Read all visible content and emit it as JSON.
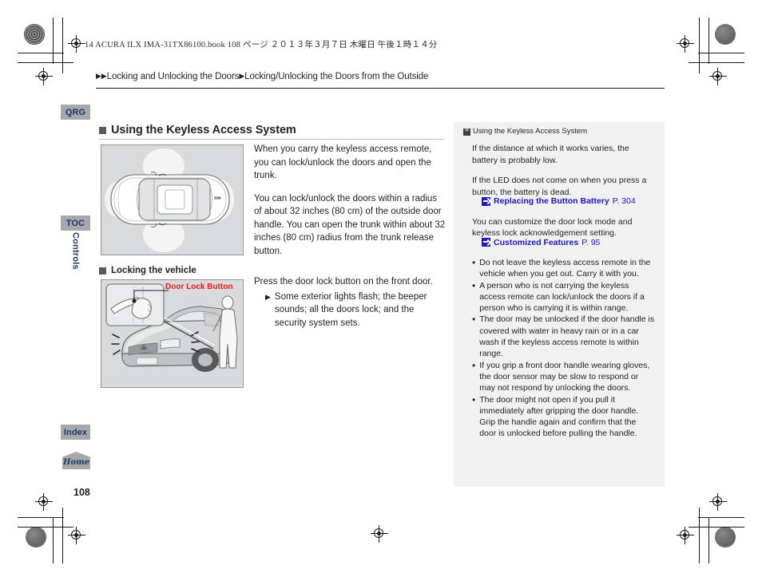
{
  "header": {
    "file_line": "14 ACURA ILX IMA-31TX86100.book   108 ページ   ２０１３年３月７日   木曜日   午後１時１４分",
    "breadcrumb_tri1": "▶",
    "breadcrumb_tri2": "▶",
    "breadcrumb_part1": "Locking and Unlocking the Doors",
    "breadcrumb_tri3": "▶",
    "breadcrumb_part2": "Locking/Unlocking the Doors from the Outside"
  },
  "sidebar": {
    "qrg": "QRG",
    "toc": "TOC",
    "chapter": "Controls",
    "index": "Index",
    "home": "Home"
  },
  "page": {
    "number": "108"
  },
  "main": {
    "section1": {
      "title": "Using the Keyless Access System",
      "paragraphs": [
        "When you carry the keyless access remote, you can lock/unlock the doors and open the trunk.",
        "You can lock/unlock the doors within a radius of about 32 inches (80 cm) of the outside door handle. You can open the trunk within about 32 inches (80 cm) radius from the trunk release button."
      ],
      "figure_caption": ""
    },
    "section2": {
      "title": "Locking the vehicle",
      "intro": "Press the door lock button on the front door.",
      "sub_marker": "▶",
      "sub_text": "Some exterior lights flash; the beeper sounds; all the doors lock; and the security system sets.",
      "callout": "Door Lock Button",
      "callout_color": "#ed1c24"
    }
  },
  "side_panel": {
    "title": "Using the Keyless Access System",
    "paragraphs": [
      "If the distance at which it works varies, the battery is probably low.",
      "If the LED does not come on when you press a button, the battery is dead."
    ],
    "xref1": {
      "name": "Replacing the Button Battery",
      "page": "P. 304"
    },
    "paragraph3": "You can customize the door lock mode and keyless lock acknowledgement setting.",
    "xref2": {
      "name": "Customized Features",
      "page": "P. 95"
    },
    "bullet_marker": "•",
    "bullets": [
      "Do not leave the keyless access remote in the vehicle when you get out. Carry it with you.",
      "A person who is not carrying the keyless access remote can lock/unlock the doors if a person who is carrying it is within range.",
      "The door may be unlocked if the door handle is covered with water in heavy rain or in a car wash if the keyless access remote is within range.",
      "If you grip a front door handle wearing gloves, the door sensor may be slow to respond or may not respond by unlocking the doors.",
      "The door might not open if you pull it immediately after gripping the door handle. Grip the handle again and confirm that the door is unlocked before pulling the handle."
    ]
  },
  "colors": {
    "link_blue": "#1a18d0",
    "tab_gray": "#a6a8ab",
    "tab_text": "#1f3864",
    "panel_bg": "#f1f1f1",
    "figure_bg": "#d9dadb"
  }
}
